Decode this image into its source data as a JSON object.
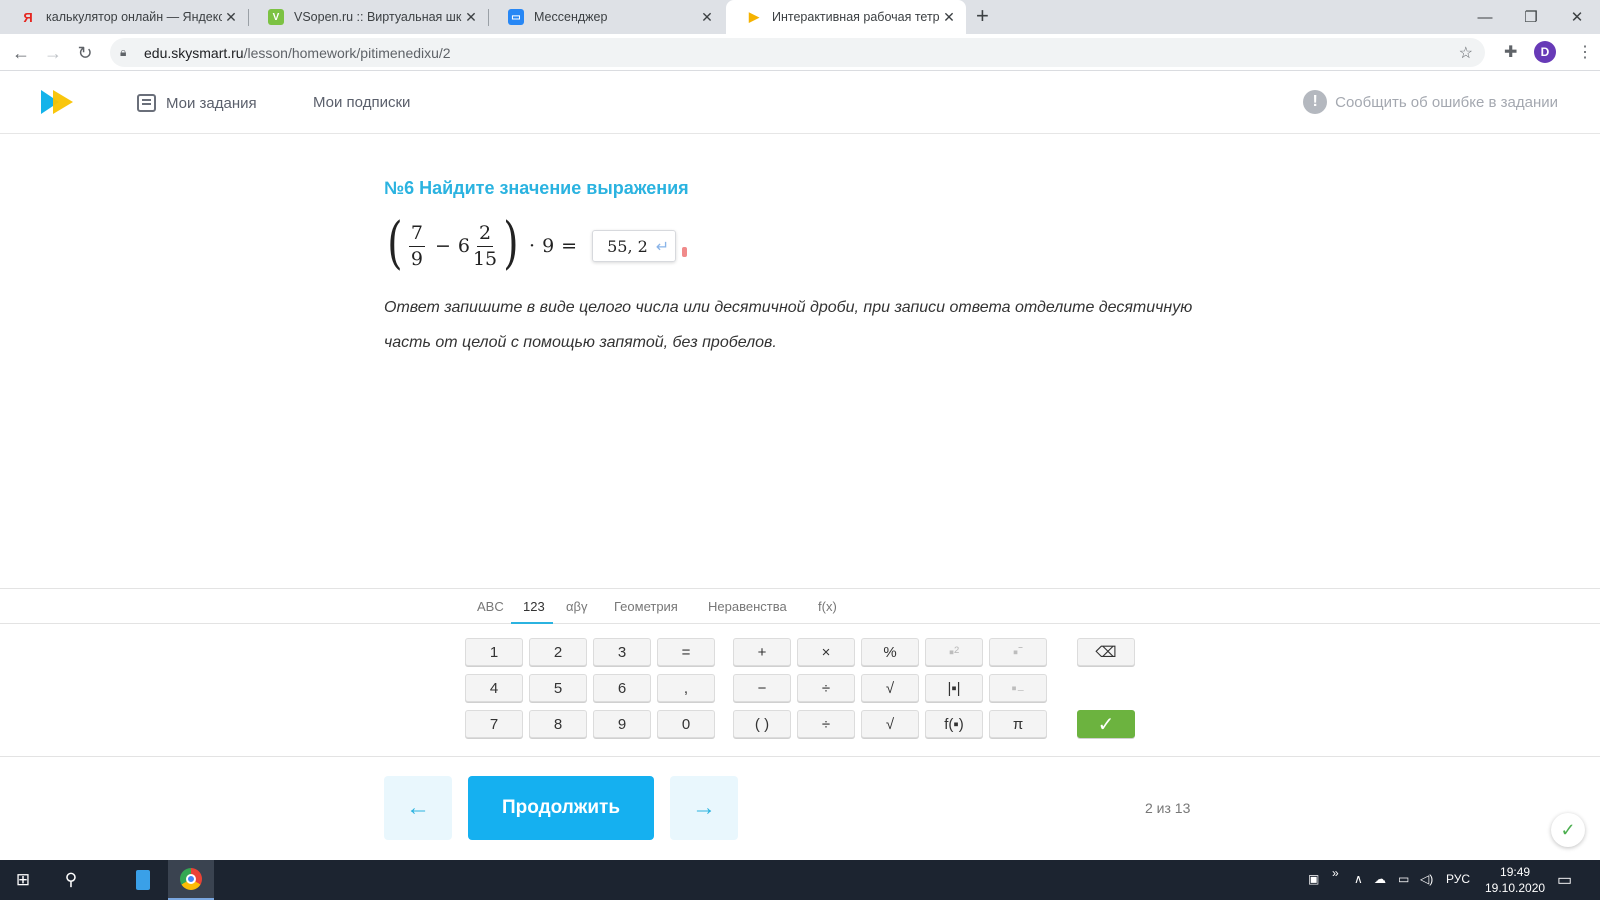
{
  "browser": {
    "tabs": [
      {
        "title": "калькулятор онлайн — Яндекс:",
        "favicon": "yandex-icon"
      },
      {
        "title": "VSopen.ru :: Виртуальная школа",
        "favicon": "vsopen-icon"
      },
      {
        "title": "Мессенджер",
        "favicon": "messenger-icon"
      },
      {
        "title": "Интерактивная рабочая тетрадь",
        "favicon": "skysmart-icon"
      }
    ],
    "new_tab": "+",
    "url_host": "edu.skysmart.ru",
    "url_path": "/lesson/homework/pitimenedixu/2",
    "profile_initial": "D"
  },
  "header": {
    "nav": [
      "Мои задания",
      "Мои подписки"
    ],
    "report": "Сообщить об ошибке в задании"
  },
  "task": {
    "title": "№6 Найдите значение выражения",
    "expression": {
      "frac1_num": "7",
      "frac1_den": "9",
      "minus": "−",
      "whole": "6",
      "frac2_num": "2",
      "frac2_den": "15",
      "times": "·",
      "factor": "9",
      "equals": "=",
      "answer": "55, 2",
      "enter_symbol": "↵"
    },
    "hint": "Ответ запишите в виде целого числа или десятичной дроби, при записи ответа отделите десятичную часть от целой с помощью запятой, без пробелов."
  },
  "keyboard": {
    "tabs": [
      "ABC",
      "123",
      "αβγ",
      "Геометрия",
      "Неравенства",
      "f(x)"
    ],
    "active_tab": "123",
    "keys": {
      "k1": "1",
      "k2": "2",
      "k3": "3",
      "eq": "=",
      "k4": "4",
      "k5": "5",
      "k6": "6",
      "comma": ",",
      "k7": "7",
      "k8": "8",
      "k9": "9",
      "k0": "0",
      "plus": "+",
      "times": "×",
      "percent": "%",
      "minus": "−",
      "divide": "÷",
      "sqrt": "√",
      "paren": "( )",
      "fraction": "÷",
      "nroot": "√",
      "func": "f(▪)",
      "pi": "π",
      "abs": "|▪|"
    },
    "ok_symbol": "✓"
  },
  "footer": {
    "prev": "←",
    "continue": "Продолжить",
    "next": "→",
    "progress": "2 из 13"
  },
  "taskbar": {
    "lang": "РУС",
    "time": "19:49",
    "date": "19.10.2020"
  },
  "colors": {
    "accent": "#15b0f0",
    "title": "#2bb3e0",
    "ok": "#6cb33f"
  }
}
